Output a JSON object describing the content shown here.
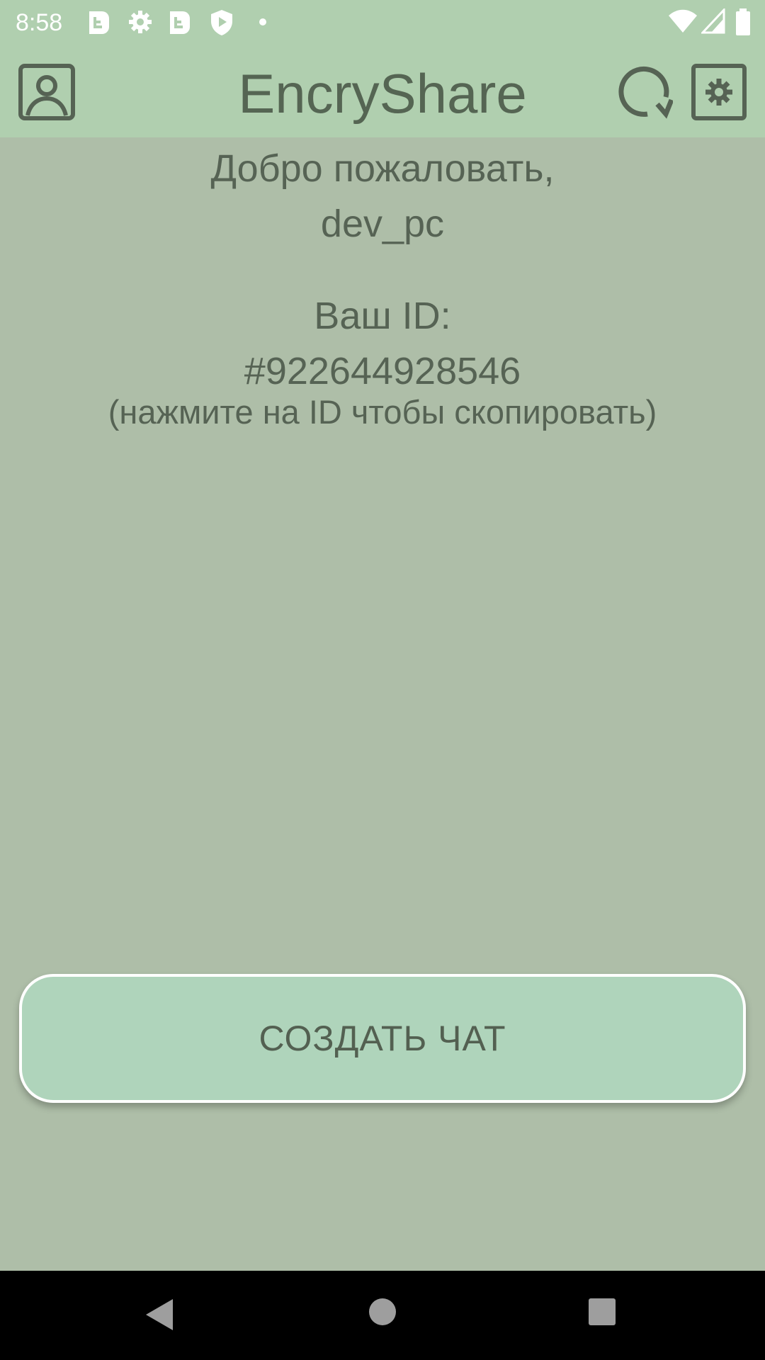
{
  "status_bar": {
    "time": "8:58",
    "icons": [
      "app-notification-icon",
      "settings-notification-icon",
      "app-notification-icon",
      "play-protect-icon",
      "dot-icon",
      "wifi-icon",
      "signal-icon",
      "battery-icon"
    ]
  },
  "app_bar": {
    "title": "EncryShare",
    "profile_icon": "profile-icon",
    "refresh_icon": "refresh-icon",
    "settings_icon": "settings-icon"
  },
  "main": {
    "welcome_line1": "Добро пожаловать,",
    "username": "dev_pc",
    "id_label": "Ваш ID:",
    "user_id": "#922644928546",
    "copy_hint": "(нажмите на ID чтобы скопировать)",
    "create_chat_label": "СОЗДАТЬ ЧАТ"
  },
  "nav_bar": {
    "back_icon": "back-icon",
    "home_icon": "home-icon",
    "recents_icon": "recents-icon"
  },
  "colors": {
    "background": "#aebea8",
    "app_bar": "#b0cfaf",
    "text": "#566354",
    "button": "#afd4bb"
  }
}
